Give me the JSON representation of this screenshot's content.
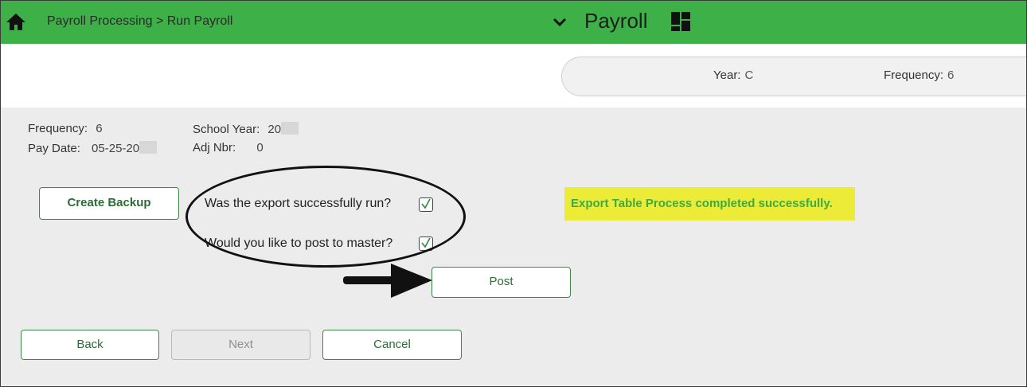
{
  "topbar": {
    "breadcrumb": "Payroll Processing > Run Payroll",
    "module_title": "Payroll",
    "icons": [
      "home-icon",
      "chevron-down-icon",
      "grid-icon"
    ]
  },
  "header": {
    "year_label": "Year:",
    "year_value": "C",
    "frequency_label": "Frequency:",
    "frequency_value": "6"
  },
  "info": {
    "frequency_label": "Frequency:",
    "frequency_value": "6",
    "school_year_label": "School Year:",
    "school_year_value": "20",
    "pay_date_label": "Pay Date:",
    "pay_date_value": "05-25-20",
    "adj_nbr_label": "Adj Nbr:",
    "adj_nbr_value": "0"
  },
  "actions": {
    "create_backup_label": "Create Backup",
    "export_question": "Was the export successfully run?",
    "export_checked": true,
    "post_question": "Would you like to post to master?",
    "post_checked": true,
    "post_label": "Post"
  },
  "status": {
    "message": "Export Table Process completed successfully."
  },
  "nav": {
    "back_label": "Back",
    "next_label": "Next",
    "cancel_label": "Cancel"
  },
  "colors": {
    "topbar_green": "#3db048",
    "button_green": "#3d8a48",
    "highlight_yellow": "#ecec38",
    "success_text": "#3cab43"
  }
}
